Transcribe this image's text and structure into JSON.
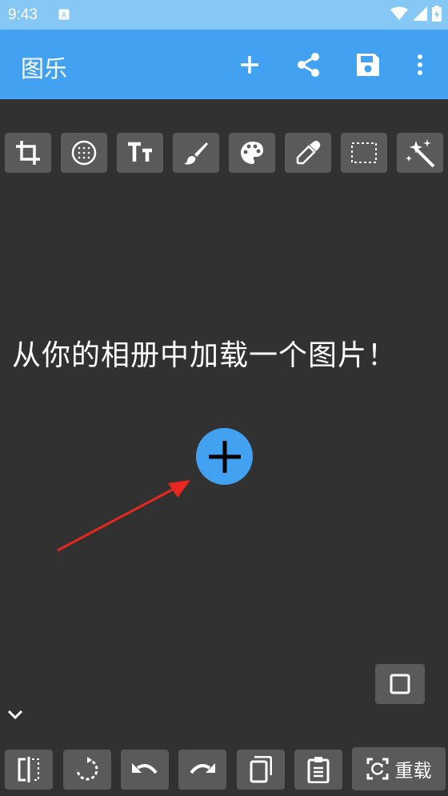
{
  "status_bar": {
    "time": "9:43"
  },
  "app_bar": {
    "title": "图乐",
    "actions": [
      "add-icon",
      "share-icon",
      "save-icon",
      "more-vert-icon"
    ]
  },
  "tools": [
    "crop-icon",
    "blur-icon",
    "text-icon",
    "brush-icon",
    "palette-icon",
    "eyedropper-icon",
    "select-rect-icon",
    "magic-wand-icon"
  ],
  "main": {
    "prompt": "从你的相册中加载一个图片！"
  },
  "bottom_tools": [
    "compare-icon",
    "rotate-icon",
    "undo-icon",
    "redo-icon",
    "copy-icon",
    "paste-icon"
  ],
  "reload_label": "重载",
  "colors": {
    "accent": "#42a1f1",
    "background": "#313131",
    "tool_bg": "#5a5a5a",
    "arrow": "#e8271f"
  }
}
